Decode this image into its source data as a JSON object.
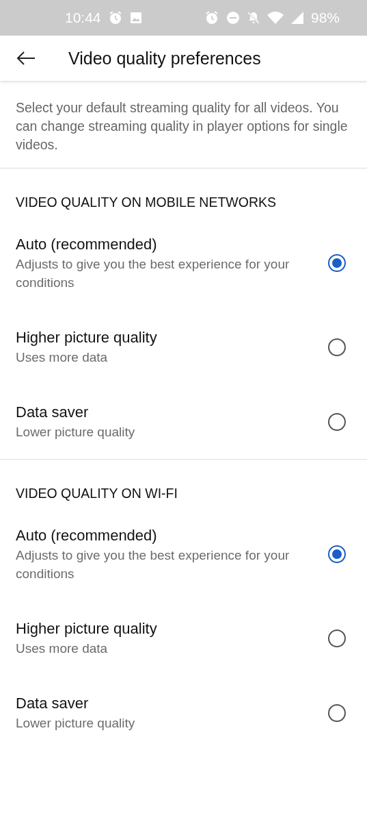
{
  "status_bar": {
    "time": "10:44",
    "battery": "98%"
  },
  "app_bar": {
    "title": "Video quality preferences"
  },
  "description": "Select your default streaming quality for all videos. You can change streaming quality in player options for single videos.",
  "sections": [
    {
      "heading": "VIDEO QUALITY ON MOBILE NETWORKS",
      "options": [
        {
          "title": "Auto (recommended)",
          "subtitle": "Adjusts to give you the best experience for your conditions",
          "selected": true
        },
        {
          "title": "Higher picture quality",
          "subtitle": "Uses more data",
          "selected": false
        },
        {
          "title": "Data saver",
          "subtitle": "Lower picture quality",
          "selected": false
        }
      ]
    },
    {
      "heading": "VIDEO QUALITY ON WI-FI",
      "options": [
        {
          "title": "Auto (recommended)",
          "subtitle": "Adjusts to give you the best experience for your conditions",
          "selected": true
        },
        {
          "title": "Higher picture quality",
          "subtitle": "Uses more data",
          "selected": false
        },
        {
          "title": "Data saver",
          "subtitle": "Lower picture quality",
          "selected": false
        }
      ]
    }
  ]
}
